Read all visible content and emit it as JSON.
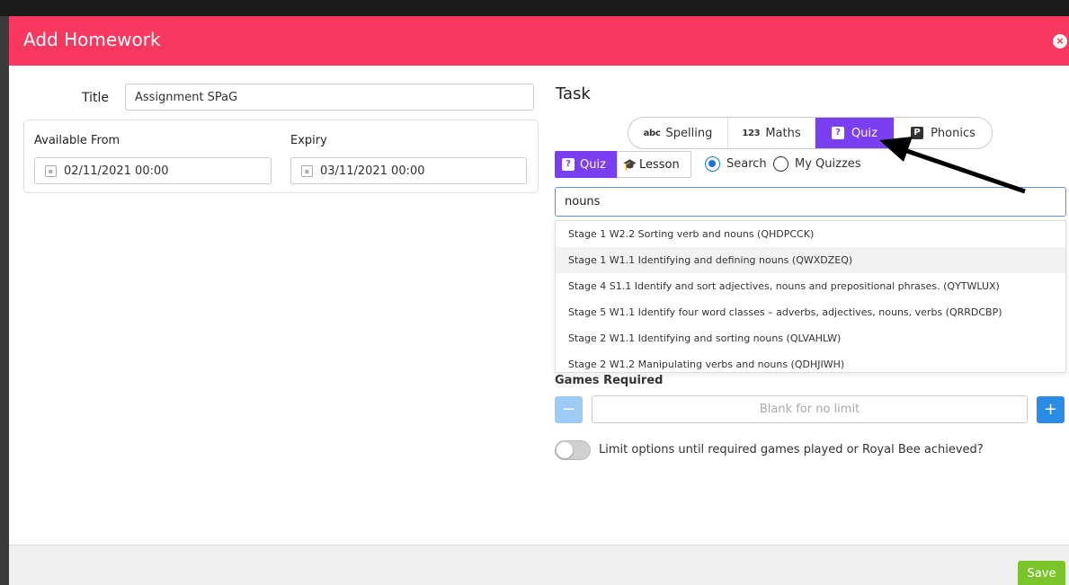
{
  "modal": {
    "title": "Add Homework",
    "close_label": "×"
  },
  "form": {
    "title_label": "Title",
    "title_value": "Assignment SPaG",
    "available_from_label": "Available From",
    "available_from_value": "02/11/2021 00:00",
    "expiry_label": "Expiry",
    "expiry_value": "03/11/2021 00:00"
  },
  "task": {
    "heading": "Task",
    "categories": [
      {
        "glyph": "abc",
        "label": "Spelling",
        "active": false
      },
      {
        "glyph": "123",
        "label": "Maths",
        "active": false
      },
      {
        "glyph": "?",
        "label": "Quiz",
        "active": true
      },
      {
        "glyph": "P",
        "label": "Phonics",
        "active": false
      }
    ],
    "sub_tabs": [
      {
        "glyph": "?",
        "label": "Quiz",
        "active": true
      },
      {
        "label": "Lesson",
        "active": false
      }
    ],
    "search_mode": {
      "options": [
        "Search",
        "My Quizzes"
      ],
      "selected": "Search"
    },
    "search_value": "nouns",
    "results": [
      "Stage 1 W2.2 Sorting verb and nouns (QHDPCCK)",
      "Stage 1 W1.1 Identifying and defining nouns (QWXDZEQ)",
      "Stage 4 S1.1 Identify and sort adjectives, nouns and prepositional phrases. (QYTWLUX)",
      "Stage 5 W1.1 Identify four word classes – adverbs, adjectives, nouns, verbs (QRRDCBP)",
      "Stage 2 W1.1 Identifying and sorting nouns (QLVAHLW)",
      "Stage 2 W1.2 Manipulating verbs and nouns (QDHJIWH)"
    ],
    "hovered_result_index": 1,
    "games_required_label": "Games Required",
    "games_placeholder": "Blank for no limit",
    "minus_label": "−",
    "plus_label": "+",
    "limit_toggle_label": "Limit options until required games played or Royal Bee achieved?",
    "limit_toggle_on": false
  },
  "footer": {
    "save_label": "Save"
  },
  "colors": {
    "header": "#f8385e",
    "accent_purple": "#7b3ff2",
    "save_green": "#7cc42c",
    "plus_blue": "#2b8ce6"
  }
}
